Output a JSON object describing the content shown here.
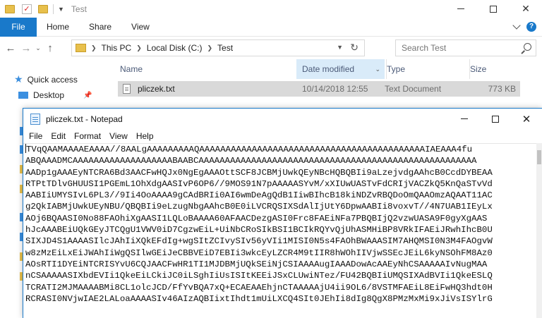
{
  "explorer": {
    "title": "Test",
    "ribbon_tabs": [
      "File",
      "Home",
      "Share",
      "View"
    ],
    "breadcrumb": [
      "This PC",
      "Local Disk (C:)",
      "Test"
    ],
    "search_placeholder": "Search Test",
    "nav": {
      "quick_access": "Quick access",
      "desktop": "Desktop"
    },
    "columns": {
      "name": "Name",
      "date": "Date modified",
      "type": "Type",
      "size": "Size"
    },
    "files": [
      {
        "name": "pliczek.txt",
        "date": "10/14/2018 12:55",
        "type": "Text Document",
        "size": "773 KB"
      }
    ]
  },
  "notepad": {
    "title": "pliczek.txt - Notepad",
    "menu": [
      "File",
      "Edit",
      "Format",
      "View",
      "Help"
    ],
    "lines": [
      "TVqQAAMAAAAEAAAA//8AALgAAAAAAAAAQAAAAAAAAAAAAAAAAAAAAAAAAAAAAAAAAAAAAAAAAAAAIAEAAA4fu",
      "ABQAAADMCAAAAAAAAAAAAAAAAAAABAABCAAAAAAAAAAAAAAAAAAAAAAAAAAAAAAAAAAAAAAAAAAAAAAAAAAAAA",
      "AADp1gAAAEyNTCRA6Bd3AACFwHQJx0NgEgAAAOttSCF8JCBMjUwkQEyNBcHQBQBIi9aLzejvdgAAhcB0CcdDYBEAA",
      "RTPtTDlvGHUUSI1PGEmL1OhXdgAASIvP6OP6//9MOS91N7pAAAAASYvM/xXIUwUASTvFdCRIjVACZkQ5KnQaSTvVd",
      "AABIiUMYSIvL6PL3//9Ii4OoAAAA9gCAdBRIi0AI6wmDeAgQdB1IiwBIhcB18kiNDZvRBQDoOmQAAOmzAQAAT11AC",
      "g2QkIABMjUwkUEyNBU/QBQBIi9eLzugNbgAAhcB0E0iLVCRQSIXSdAlIjUtY6DpwAABIi8voxvT//4N7UAB1IEyLx",
      "AOj6BQAASI0No88FAOhiXgAASI1LQLoBAAAA60AFAACDezgASI0Frc8FAEiNFa7PBQBIjQ2vzwUASA9F0gyXgAAS",
      "hJcAAABEiUQkGEyJTCQgU1VWV0iD7CgzwEiL+UiNbCRoSIkBSI1BCIkRQYvQjUhASMHiBP8VRkIFAEiJRwhIhcB0U",
      "SIXJD4S1AAAASIlcJAhIiXQkEFdIg+wgSItZCIvySIv56yVIi1MISI0N5s4FAOhBWAAASIM7AHQMSI0N3M4FAOgvW",
      "w8zMzEiLxEiJWAhIiWgQSIlwGEiJeCBBVEiD7EBIi3wkcEyLZCR4M9tIIR8hWOhIIVjwSSEcJEiL6kyNSOhFM8Az0",
      "AOsRTI1DYEiNTCRISYvU6CQJAACFwHR1TI1MJDBMjUQkSEiNjCSIAAAAugIAAADowAcAAEyNhCSAAAAAIvNugMAA",
      "nCSAAAAASIXbdEVIi1QkeEiLCkiJC0iLSghIiUsISItKEEiJSxCLUwiNTez/FU42BQBIiUMQSIXAdBVIi1QkeESLQ",
      "TCRATI2MJMAAAABMi8CL1olcJCD/FfYvBQA7xQ+ECAEAAEhjnCTAAAAAjU4ii9OL6/8VSTMFAEiL8EiFwHQ3hdt0H",
      "RCRASI0NVjwIAE2LALoaAAAASIv46AIzAQBIixtIhdt1mUiLXCQ4SIt0JEhIi8dIg8QgX8PMzMxMi9xJiVsISYlrG"
    ]
  }
}
